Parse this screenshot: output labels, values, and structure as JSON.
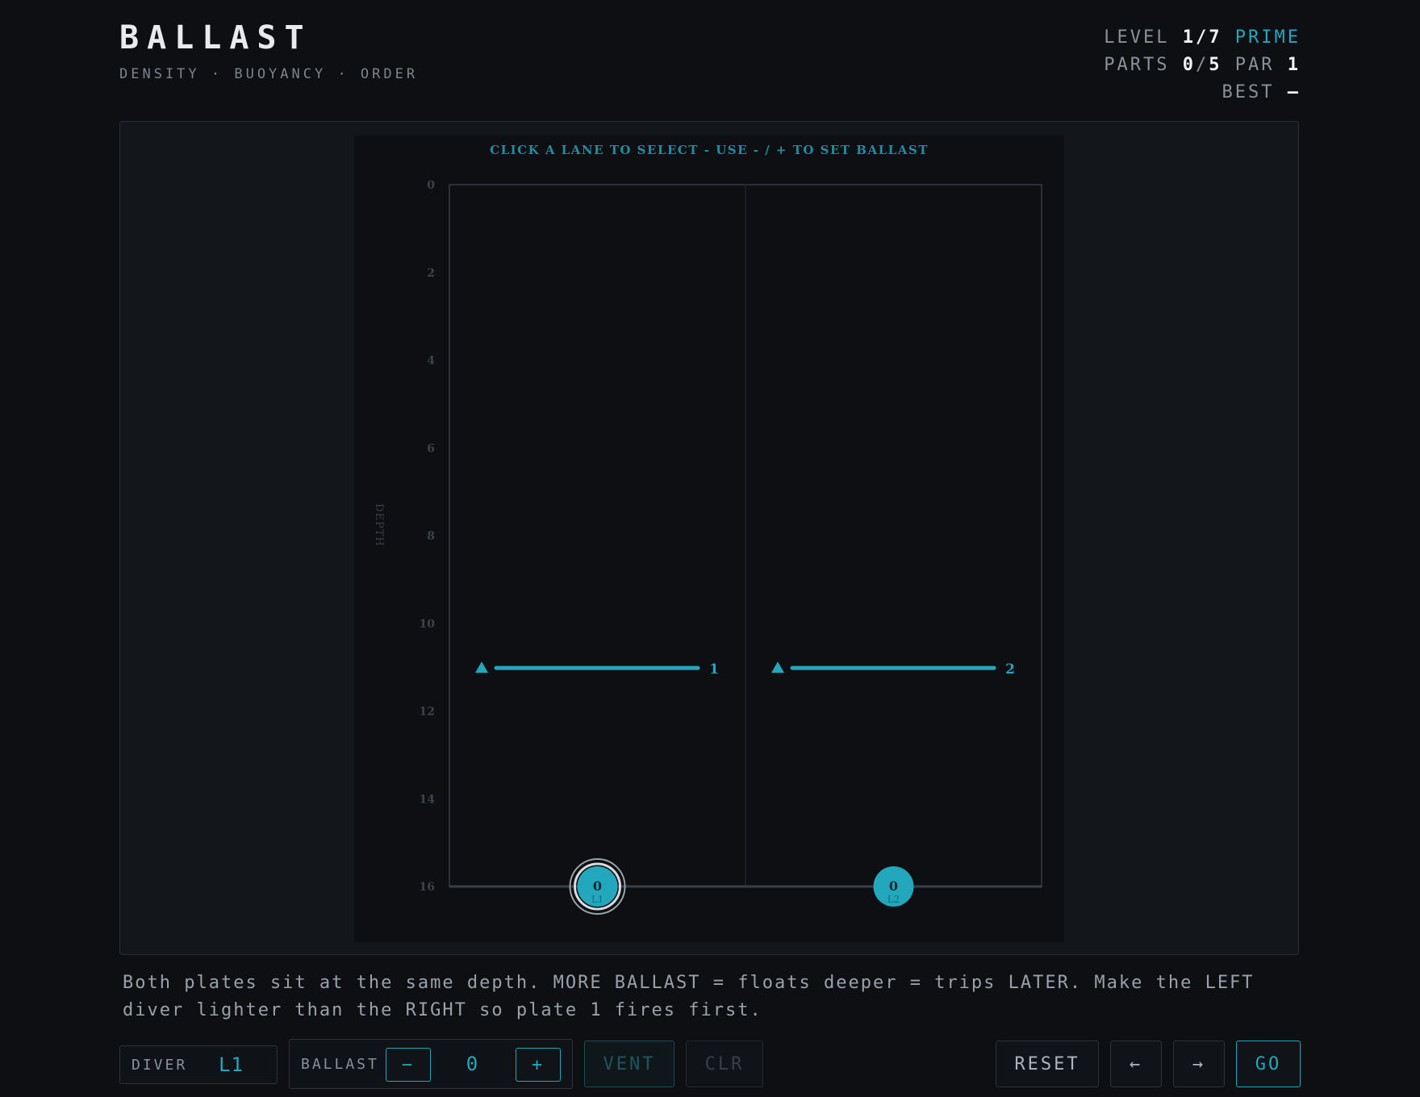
{
  "header": {
    "title": "BALLAST",
    "subtitle": "DENSITY · BUOYANCY · ORDER"
  },
  "stats": {
    "level_label": "LEVEL",
    "level_current": "1",
    "level_total": "7",
    "level_name": "PRIME",
    "parts_label": "PARTS",
    "parts_used": "0",
    "parts_total": "5",
    "par_label": "PAR",
    "par_value": "1",
    "best_label": "BEST",
    "best_value": "—"
  },
  "board": {
    "instruction": "CLICK A LANE TO SELECT - USE - / + TO SET BALLAST",
    "axis_label": "DEPTH",
    "depth_ticks": [
      0,
      2,
      4,
      6,
      8,
      10,
      12,
      14,
      16
    ],
    "depth_max": 16,
    "lanes": [
      {
        "id": "L1",
        "plate_number": "1",
        "plate_depth": 11,
        "diver_ballast": "0",
        "diver_depth": 16,
        "selected": true
      },
      {
        "id": "L2",
        "plate_number": "2",
        "plate_depth": 11,
        "diver_ballast": "0",
        "diver_depth": 16,
        "selected": false
      }
    ]
  },
  "hint": "Both plates sit at the same depth. MORE BALLAST = floats deeper = trips LATER. Make the LEFT diver lighter than the RIGHT so plate 1 fires first.",
  "controls": {
    "diver_label": "DIVER",
    "diver_value": "L1",
    "ballast_label": "BALLAST",
    "minus": "−",
    "ballast_value": "0",
    "plus": "+",
    "vent": "VENT",
    "clr": "CLR",
    "reset": "RESET",
    "prev": "←",
    "next": "→",
    "go": "GO"
  },
  "colors": {
    "accent": "#22a7bd",
    "background": "#0d0f13",
    "panel": "#13161a"
  }
}
